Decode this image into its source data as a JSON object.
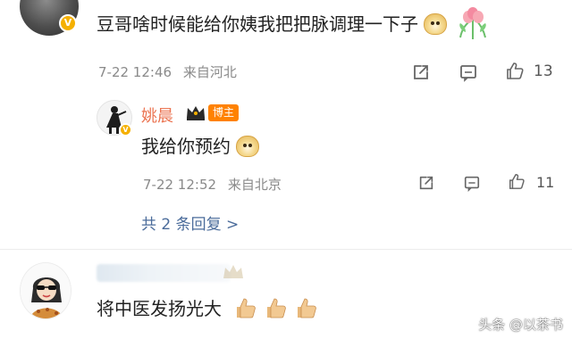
{
  "comment": {
    "text": "豆哥啥时候能给你姨我把把脉调理一下子",
    "emoji_1": "doge-emoji",
    "emoji_2": "tulip-emoji",
    "time": "7-22 12:46",
    "location": "来自河北",
    "likes": "13"
  },
  "reply": {
    "username": "姚晨",
    "badge": "博主",
    "text": "我给你预约",
    "emoji": "doge-emoji",
    "time": "7-22 12:52",
    "location": "来自北京",
    "likes": "11",
    "more_label": "共 2 条回复 >"
  },
  "second_comment": {
    "text": "将中医发扬光大",
    "emoji": "thumbs-up-emoji"
  },
  "watermark": "头条 @以茶书",
  "colors": {
    "username": "#eb7350",
    "badge_bg": "#ff8200",
    "link": "#4b6c9b",
    "meta": "#8a8a8a",
    "verify": "#f5b000"
  }
}
